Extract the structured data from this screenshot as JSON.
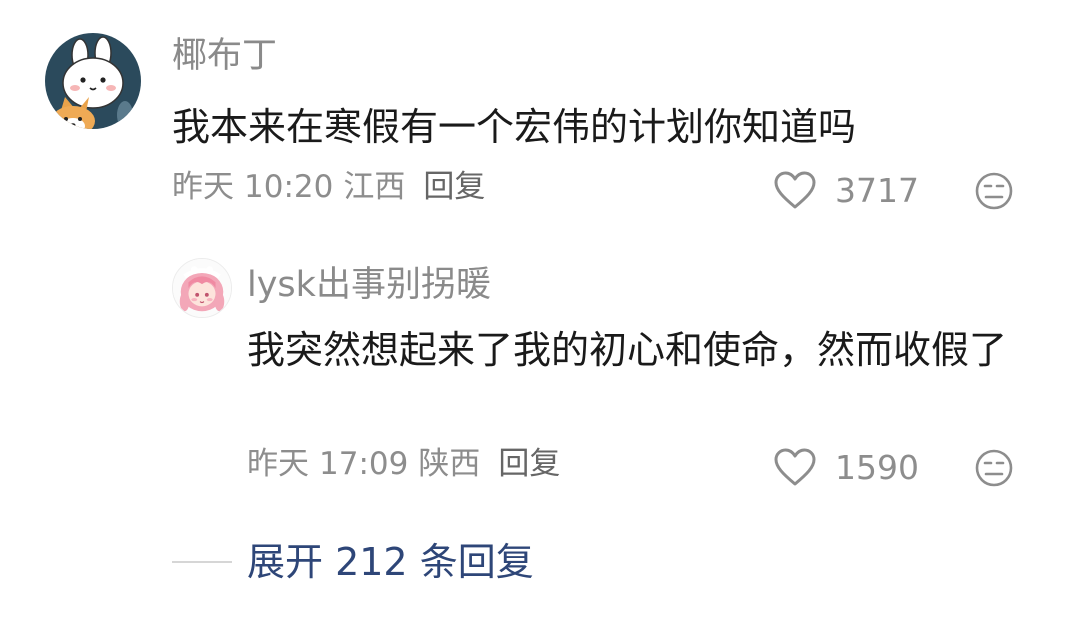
{
  "comment": {
    "username": "椰布丁",
    "content": "我本来在寒假有一个宏伟的计划你知道吗",
    "date": "昨天",
    "time": "10:20",
    "location": "江西",
    "reply_label": "回复",
    "like_count": "3717",
    "avatar_icon": "bunny-and-corgi-avatar",
    "like_icon": "heart-outline-icon",
    "dislike_icon": "unhappy-face-icon"
  },
  "reply": {
    "username": "lysk出事别拐暖",
    "content": "我突然想起来了我的初心和使命，然而收假了",
    "date": "昨天",
    "time": "17:09",
    "location": "陕西",
    "reply_label": "回复",
    "like_count": "1590",
    "avatar_icon": "pink-hair-girl-avatar",
    "like_icon": "heart-outline-icon",
    "dislike_icon": "unhappy-face-icon"
  },
  "expand": {
    "label": "展开 212 条回复"
  },
  "colors": {
    "link": "#2e4678",
    "meta": "#8d8d8d",
    "avatar_bg": "#2b4a5c"
  }
}
